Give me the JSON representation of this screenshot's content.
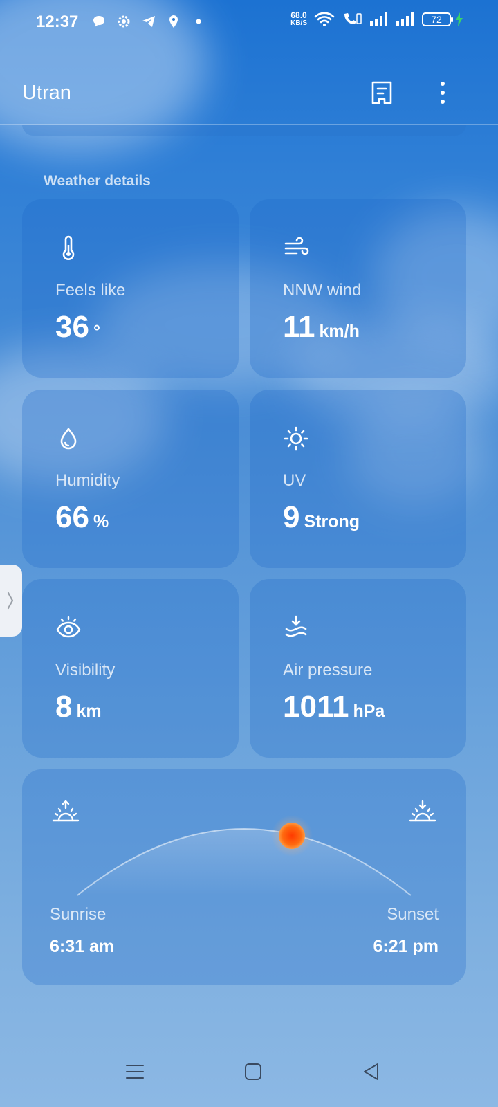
{
  "status_bar": {
    "time": "12:37",
    "net_speed_value": "68.0",
    "net_speed_unit": "KB/S",
    "battery": "72"
  },
  "app_bar": {
    "title": "Utran"
  },
  "section": {
    "title": "Weather details"
  },
  "details": [
    {
      "label": "Feels like",
      "value": "36",
      "unit": "°",
      "icon": "thermometer-icon"
    },
    {
      "label": "NNW wind",
      "value": "11",
      "unit": "km/h",
      "icon": "wind-icon"
    },
    {
      "label": "Humidity",
      "value": "66",
      "unit": "%",
      "icon": "droplet-icon"
    },
    {
      "label": "UV",
      "value": "9",
      "unit": "Strong",
      "icon": "sun-icon"
    },
    {
      "label": "Visibility",
      "value": "8",
      "unit": "km",
      "icon": "eye-icon"
    },
    {
      "label": "Air pressure",
      "value": "1011",
      "unit": "hPa",
      "icon": "pressure-icon"
    }
  ],
  "sun": {
    "sunrise_label": "Sunrise",
    "sunrise_time": "6:31 am",
    "sunset_label": "Sunset",
    "sunset_time": "6:21 pm"
  },
  "colors": {
    "sky_top": "#1c72d2",
    "sky_bottom": "#8cb8e4",
    "sun": "#ff5a10"
  }
}
